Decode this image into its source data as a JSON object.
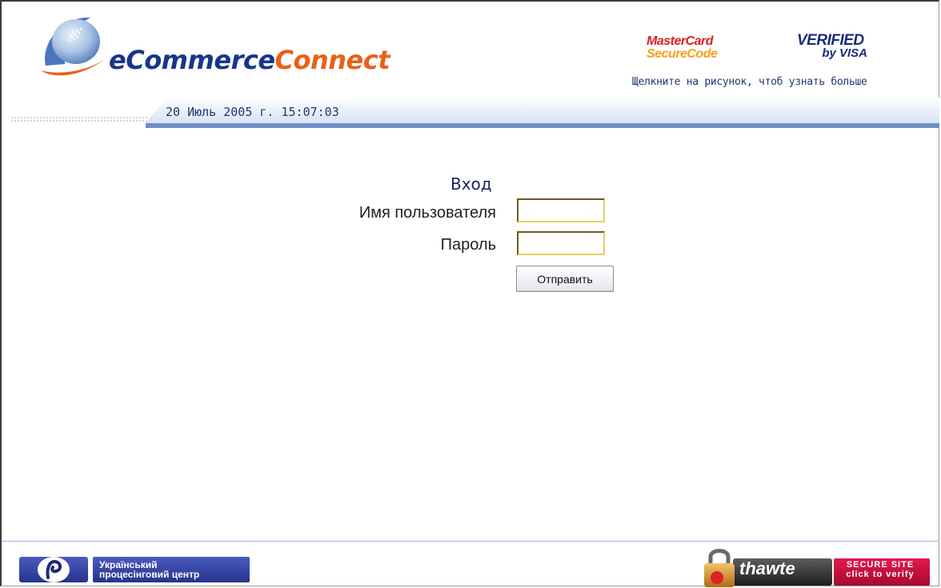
{
  "brand": {
    "logo_part1": "eCommerce",
    "logo_part2": "Connect"
  },
  "partners": {
    "mastercard_line1": "MasterCard",
    "mastercard_line2": "SecureCode",
    "visa_line1": "VERIFIED",
    "visa_line2": "by VISA",
    "click_hint": "Щелкните на рисунок, чтоб узнать больше"
  },
  "datetime": "20 Июль 2005 г. 15:07:03",
  "login": {
    "title": "Вход",
    "username_label": "Имя пользователя",
    "username_value": "",
    "password_label": "Пароль",
    "password_value": "",
    "submit_label": "Отправить"
  },
  "footer": {
    "upc_line1": "Український",
    "upc_line2": "процесінговий центр",
    "thawte_brand": "thawte",
    "thawte_secure_line1": "SECURE SITE",
    "thawte_secure_line2": "click to verify"
  },
  "colors": {
    "brand_blue": "#17368a",
    "brand_orange": "#e8611a",
    "text_navy": "#1f3770",
    "upc_blue": "#2b3890",
    "thawte_red": "#c8103e"
  },
  "icons": [
    "ecommerce-logo-icon",
    "padlock-icon",
    "upc-logo-icon"
  ]
}
